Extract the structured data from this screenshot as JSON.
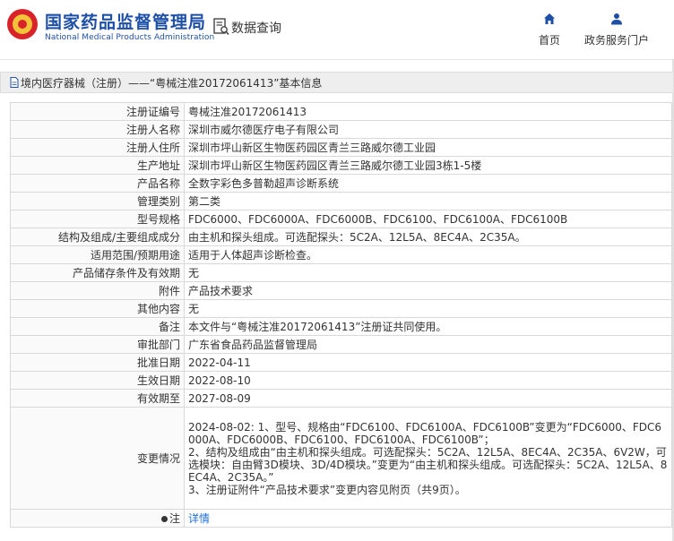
{
  "header": {
    "brand_cn": "国家药品监督管理局",
    "brand_en": "National Medical Products Administration",
    "query_title": "数据查询",
    "nav": [
      {
        "label": "首页",
        "icon": "home-icon"
      },
      {
        "label": "政务服务门户",
        "icon": "user-icon"
      }
    ]
  },
  "breadcrumb": "境内医疗器械（注册）——“粤械注准20172061413”基本信息",
  "rows": [
    {
      "key": "注册证编号",
      "value": "粤械注准20172061413"
    },
    {
      "key": "注册人名称",
      "value": "深圳市威尔德医疗电子有限公司"
    },
    {
      "key": "注册人住所",
      "value": "深圳市坪山新区生物医药园区青兰三路威尔德工业园"
    },
    {
      "key": "生产地址",
      "value": "深圳市坪山新区生物医药园区青兰三路威尔德工业园3栋1-5楼"
    },
    {
      "key": "产品名称",
      "value": "全数字彩色多普勒超声诊断系统"
    },
    {
      "key": "管理类别",
      "value": "第二类"
    },
    {
      "key": "型号规格",
      "value": "FDC6000、FDC6000A、FDC6000B、FDC6100、FDC6100A、FDC6100B"
    },
    {
      "key": "结构及组成/主要组成成分",
      "value": "由主机和探头组成。可选配探头：5C2A、12L5A、8EC4A、2C35A。"
    },
    {
      "key": "适用范围/预期用途",
      "value": "适用于人体超声诊断检查。"
    },
    {
      "key": "产品储存条件及有效期",
      "value": "无"
    },
    {
      "key": "附件",
      "value": "产品技术要求"
    },
    {
      "key": "其他内容",
      "value": "无"
    },
    {
      "key": "备注",
      "value": "本文件与“粤械注准20172061413”注册证共同使用。"
    },
    {
      "key": "审批部门",
      "value": "广东省食品药品监督管理局"
    },
    {
      "key": "批准日期",
      "value": "2022-04-11"
    },
    {
      "key": "生效日期",
      "value": "2022-08-10"
    },
    {
      "key": "有效期至",
      "value": "2027-08-09"
    }
  ],
  "change": {
    "key": "变更情况",
    "lines": [
      "2024-08-02: 1、型号、规格由“FDC6100、FDC6100A、FDC6100B”变更为“FDC6000、FDC6000A、FDC6000B、FDC6100、FDC6100A、FDC6100B”；",
      "2、结构及组成由“由主机和探头组成。可选配探头：5C2A、12L5A、8EC4A、2C35A、6V2W，可选模块：自由臂3D模块、3D/4D模块。”变更为“由主机和探头组成。可选配探头：5C2A、12L5A、8EC4A、2C35A。”",
      "3、注册证附件“产品技术要求”变更内容见附页（共9页）。"
    ]
  },
  "note": {
    "key": "注",
    "link": "详情"
  }
}
